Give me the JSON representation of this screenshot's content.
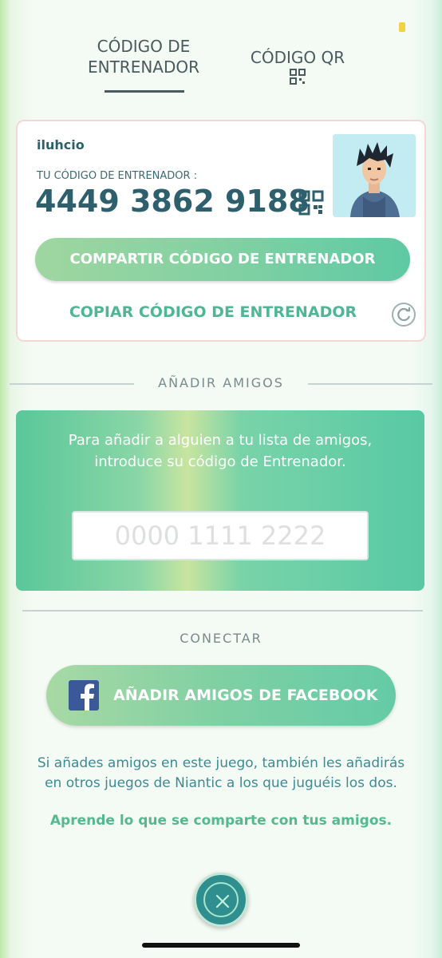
{
  "tabs": {
    "trainer_code": "CÓDIGO DE ENTRENADOR",
    "qr_code": "CÓDIGO QR"
  },
  "card": {
    "username": "iluhcio",
    "code_label": "TU CÓDIGO DE ENTRENADOR :",
    "code_value": "4449 3862 9188",
    "share_button": "COMPARTIR CÓDIGO DE ENTRENADOR",
    "copy_link": "COPIAR CÓDIGO DE ENTRENADOR"
  },
  "add_friends": {
    "section_title": "AÑADIR AMIGOS",
    "instructions": "Para añadir a alguien a tu lista de amigos, introduce su código de Entrenador.",
    "input_placeholder": "0000 1111 2222",
    "input_value": ""
  },
  "connect": {
    "section_title": "CONECTAR",
    "facebook_button": "AÑADIR AMIGOS DE FACEBOOK",
    "info_text": "Si añades amigos en este juego, también les añadirás en otros juegos de Niantic a los que juguéis los dos.",
    "learn_link": "Aprende lo que se comparte con tus amigos."
  },
  "icons": {
    "qr": "qr-code-icon",
    "refresh": "refresh-icon",
    "facebook": "facebook-icon",
    "close": "close-icon"
  },
  "colors": {
    "primary_text": "#2d5f6d",
    "accent_green": "#5ec9a4",
    "close_button": "#2f8f8e"
  }
}
